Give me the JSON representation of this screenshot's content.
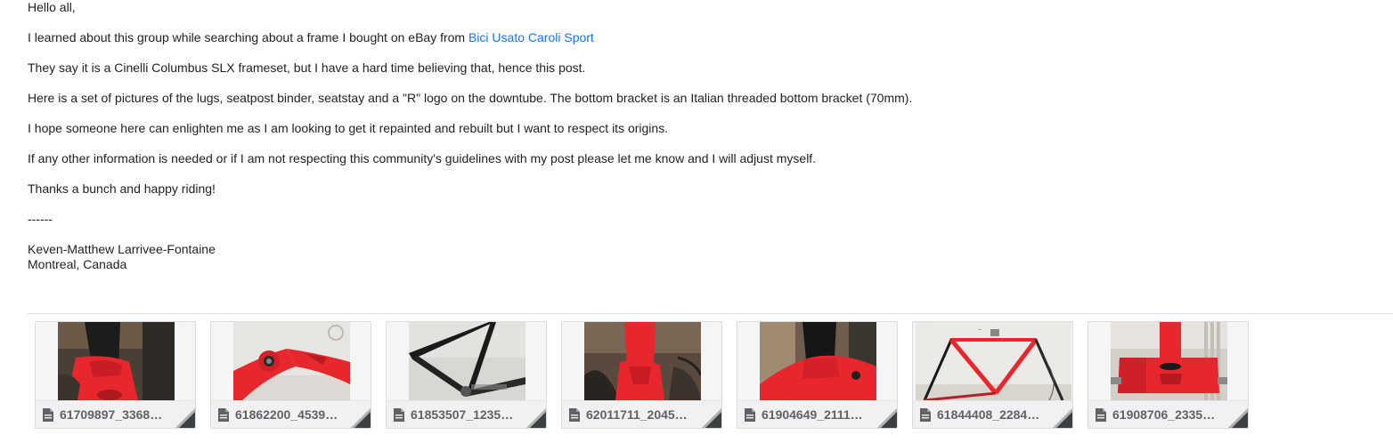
{
  "message": {
    "greeting": "Hello all,",
    "p1_text": "I learned about this group while searching about a frame I bought on eBay from ",
    "p1_link": "Bici Usato Caroli Sport",
    "p2": "They say it is a Cinelli Columbus SLX frameset, but I have a hard time believing that, hence this post.",
    "p3": "Here is a set of pictures of the lugs, seatpost binder, seatstay and a \"R\" logo on the downtube. The bottom bracket is an Italian threaded bottom bracket (70mm).",
    "p4": "I hope someone here can enlighten me as I am looking to get it repainted and rebuilt but I want to respect its origins.",
    "p5": "If any other information is needed or if I am not respecting this community's guidelines with my post please let me know and I will adjust myself.",
    "p6": "Thanks a bunch and happy riding!",
    "separator": "------",
    "signature_name": "Keven-Matthew Larrivee-Fontaine",
    "signature_location": "Montreal, Canada"
  },
  "colors": {
    "link": "#1a73e8",
    "frame_red": "#e8262e",
    "text": "#222222",
    "file_name": "#5f6368"
  },
  "attachments": [
    {
      "name": "61709897_3368…",
      "icon": "file-icon"
    },
    {
      "name": "61862200_4539…",
      "icon": "file-icon"
    },
    {
      "name": "61853507_1235…",
      "icon": "file-icon"
    },
    {
      "name": "62011711_2045…",
      "icon": "file-icon"
    },
    {
      "name": "61904649_2111…",
      "icon": "file-icon"
    },
    {
      "name": "61844408_2284…",
      "icon": "file-icon"
    },
    {
      "name": "61908706_2335…",
      "icon": "file-icon"
    }
  ]
}
